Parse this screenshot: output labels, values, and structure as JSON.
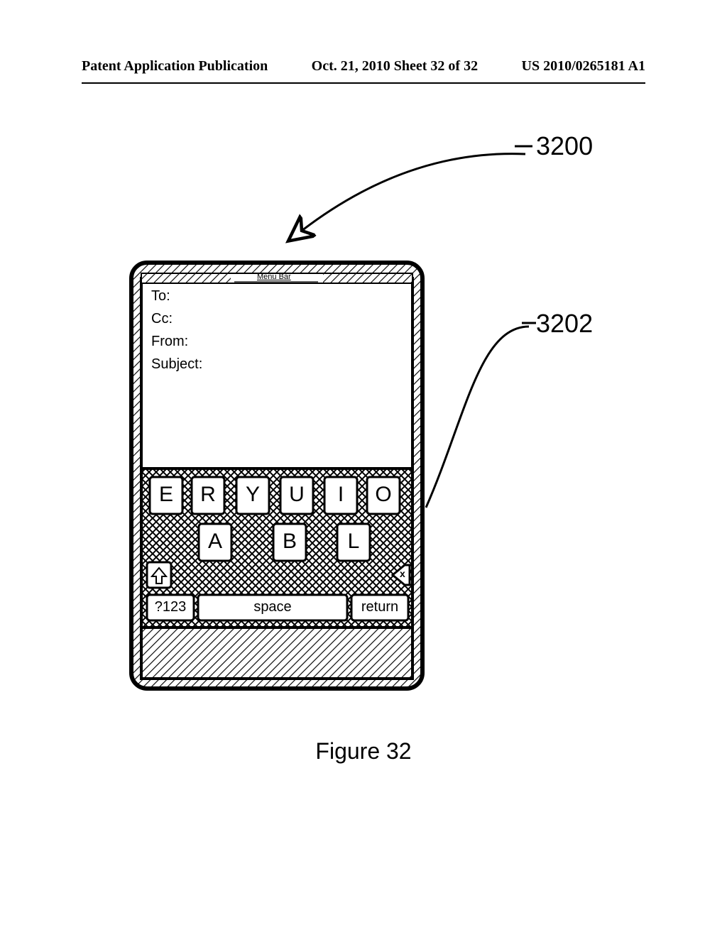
{
  "header": {
    "left": "Patent Application Publication",
    "center": "Oct. 21, 2010  Sheet 32 of 32",
    "right": "US 2010/0265181 A1"
  },
  "refs": {
    "r3200": "3200",
    "r3202": "3202"
  },
  "device": {
    "menu_bar": "Menu Bar",
    "fields": {
      "to": "To:",
      "cc": "Cc:",
      "from": "From:",
      "subject": "Subject:"
    },
    "keys_row1": [
      "E",
      "R",
      "Y",
      "U",
      "I",
      "O"
    ],
    "keys_row2": [
      "A",
      "B",
      "L"
    ],
    "keys_row3": {
      "mode": "?123",
      "space": "space",
      "return": "return"
    },
    "shift_icon": "shift-icon",
    "backspace_icon": "backspace-icon",
    "backspace_x": "x"
  },
  "caption": "Figure 32"
}
